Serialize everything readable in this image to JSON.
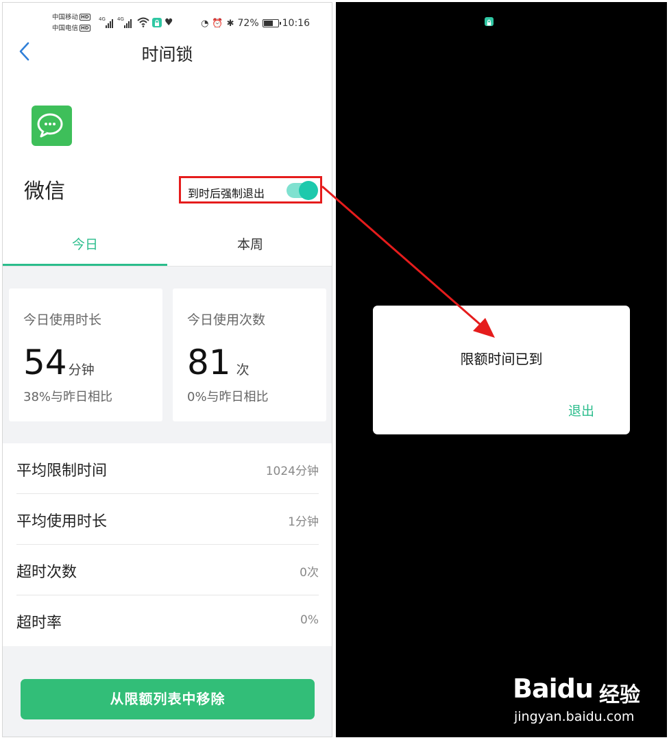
{
  "status_bar": {
    "carrier_1": "中国移动",
    "carrier_2": "中国电信",
    "hd_badge": "HD",
    "network_1": "4G",
    "network_2": "4G",
    "battery_percent": "72%",
    "battery_level": 0.72,
    "time": "10:16",
    "icons": [
      "wifi-icon",
      "lock-app-icon",
      "heart-icon",
      "data-saver-icon",
      "alarm-icon",
      "bluetooth-icon",
      "battery-icon"
    ]
  },
  "header": {
    "title": "时间锁",
    "back_icon": "chevron-left-icon"
  },
  "app": {
    "name": "微信",
    "icon": "wechat-icon",
    "icon_color": "#3ebf5a",
    "force_exit_label": "到时后强制退出",
    "force_exit_enabled": true
  },
  "tabs": [
    {
      "label": "今日",
      "active": true
    },
    {
      "label": "本周",
      "active": false
    }
  ],
  "stats": {
    "duration": {
      "label": "今日使用时长",
      "value": "54",
      "unit": "分钟",
      "compare": "38%与昨日相比"
    },
    "count": {
      "label": "今日使用次数",
      "value": "81",
      "unit": "次",
      "compare": "0%与昨日相比"
    }
  },
  "details": [
    {
      "label": "平均限制时间",
      "value": "1024分钟"
    },
    {
      "label": "平均使用时长",
      "value": "1分钟"
    },
    {
      "label": "超时次数",
      "value": "0次"
    },
    {
      "label": "超时率",
      "value": "0%"
    }
  ],
  "remove_button": {
    "label": "从限额列表中移除"
  },
  "dialog": {
    "message": "限额时间已到",
    "exit_label": "退出"
  },
  "watermark": {
    "logo_text": "Baidu",
    "logo_cn": "经验",
    "url": "jingyan.baidu.com"
  },
  "colors": {
    "accent": "#2bbd8c",
    "toggle_knob": "#1dc9ac",
    "button": "#32be78",
    "highlight": "#e51c1c"
  }
}
